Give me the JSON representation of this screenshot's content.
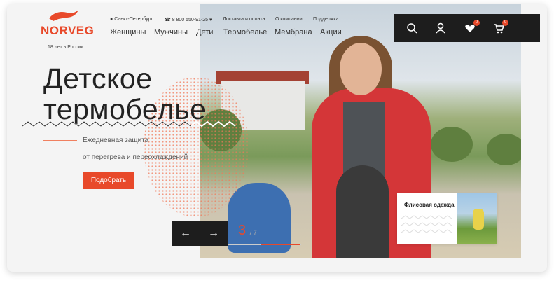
{
  "brand": {
    "name": "NORVEG",
    "tagline": "18 лет в России"
  },
  "topbar": {
    "city": "Санкт-Петербург",
    "phone": "8 800 550-91-25",
    "links": [
      "Доставка и оплата",
      "О компании",
      "Поддержка"
    ]
  },
  "nav": {
    "items": [
      "Женщины",
      "Мужчины",
      "Дети",
      "Термобелье",
      "Мембрана",
      "Акции"
    ]
  },
  "icons": {
    "wishlist_count": "0",
    "cart_count": "0"
  },
  "hero": {
    "title_line1": "Детское",
    "title_line2": "термобелье",
    "subtitle_line1": "Ежедневная защита",
    "subtitle_line2": "от перегрева и переохлаждений",
    "cta": "Подобрать"
  },
  "slider": {
    "current": "3",
    "total": "/ 7",
    "progress": 0.43
  },
  "promo": {
    "label": "Флисовая одежда"
  },
  "colors": {
    "accent": "#e8492a",
    "dark": "#1d1d1d",
    "background": "#f4f4f4"
  }
}
